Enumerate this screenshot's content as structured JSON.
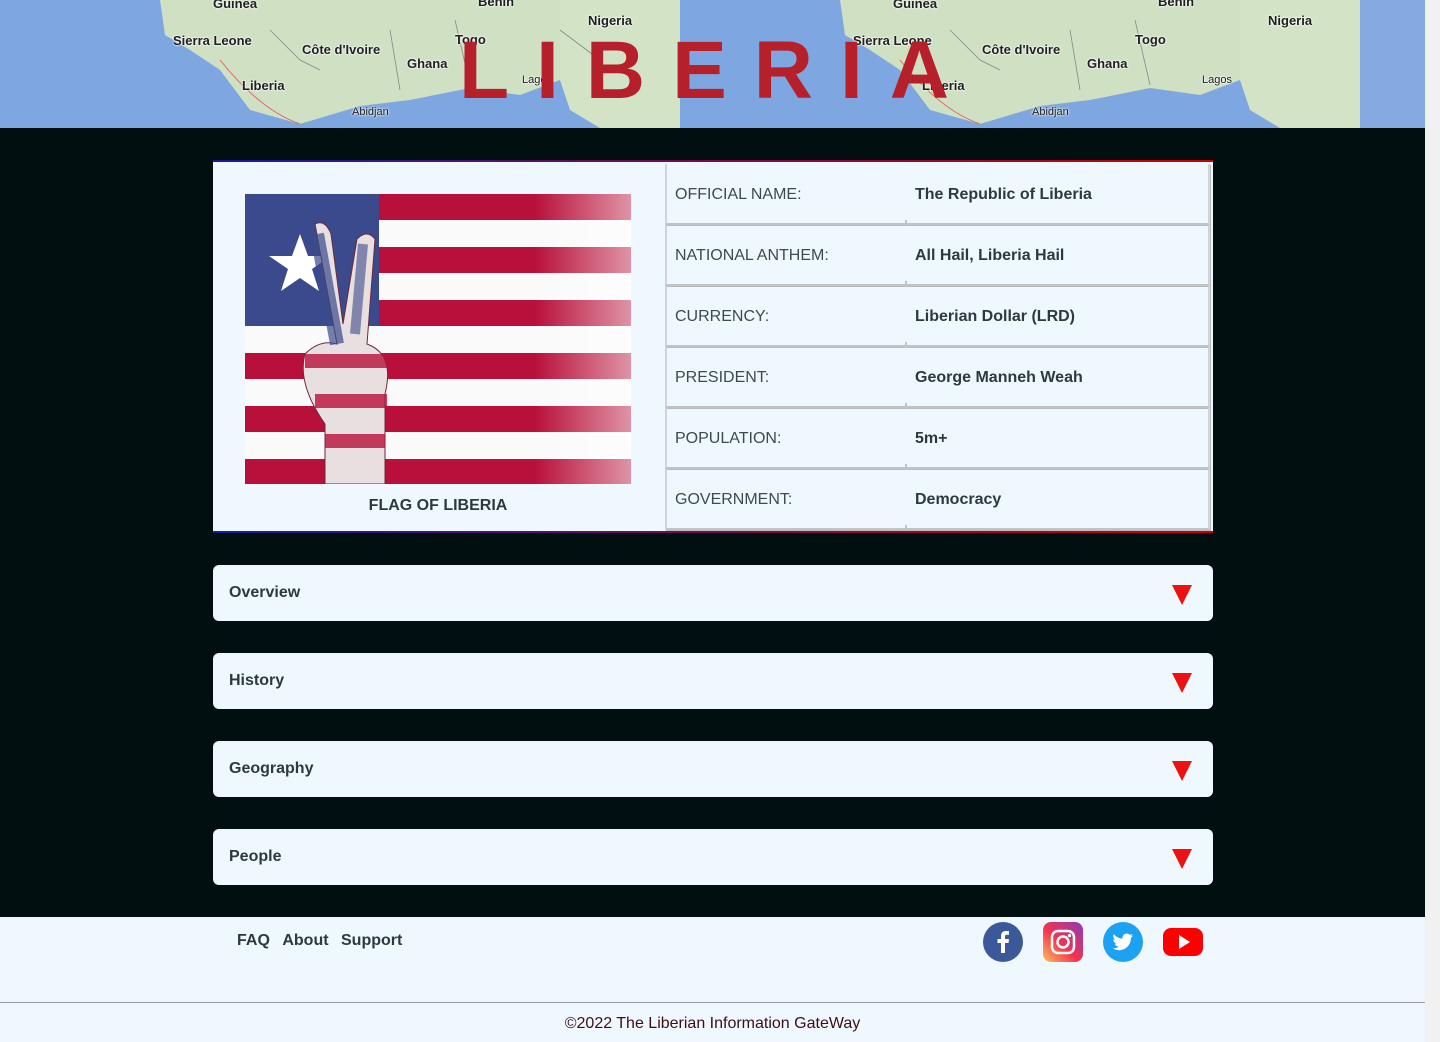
{
  "banner": {
    "title": "LIBERIA",
    "map_labels": {
      "guinea": "Guinea",
      "benin": "Benin",
      "nigeria": "Nigeria",
      "sierra_leone": "Sierra Leone",
      "cote_divoire": "Côte d'Ivoire",
      "togo": "Togo",
      "ghana": "Ghana",
      "liberia": "Liberia",
      "abidjan": "Abidjan",
      "lagos": "Lagos"
    }
  },
  "flag": {
    "caption": "FLAG OF LIBERIA"
  },
  "facts": [
    {
      "key": "OFFICIAL NAME:",
      "value": "The Republic of Liberia"
    },
    {
      "key": "NATIONAL ANTHEM:",
      "value": "All Hail, Liberia Hail"
    },
    {
      "key": "CURRENCY:",
      "value": "Liberian Dollar (LRD)"
    },
    {
      "key": "PRESIDENT:",
      "value": "George Manneh Weah"
    },
    {
      "key": "POPULATION:",
      "value": "5m+"
    },
    {
      "key": "GOVERNMENT:",
      "value": "Democracy"
    }
  ],
  "accordion": [
    {
      "label": "Overview"
    },
    {
      "label": "History"
    },
    {
      "label": "Geography"
    },
    {
      "label": "People"
    }
  ],
  "footer": {
    "links": [
      "FAQ",
      "About",
      "Support"
    ],
    "social": [
      "facebook-icon",
      "instagram-icon",
      "twitter-icon",
      "youtube-icon"
    ],
    "copyright": "©2022 The Liberian Information GateWay"
  },
  "colors": {
    "page_bg": "#010f10",
    "card_bg": "#f0f8ff",
    "title_red": "#b5202a",
    "arrow_red": "#ee1111",
    "facebook": "#3b5998",
    "twitter": "#1da1f2",
    "youtube": "#ff0000"
  }
}
